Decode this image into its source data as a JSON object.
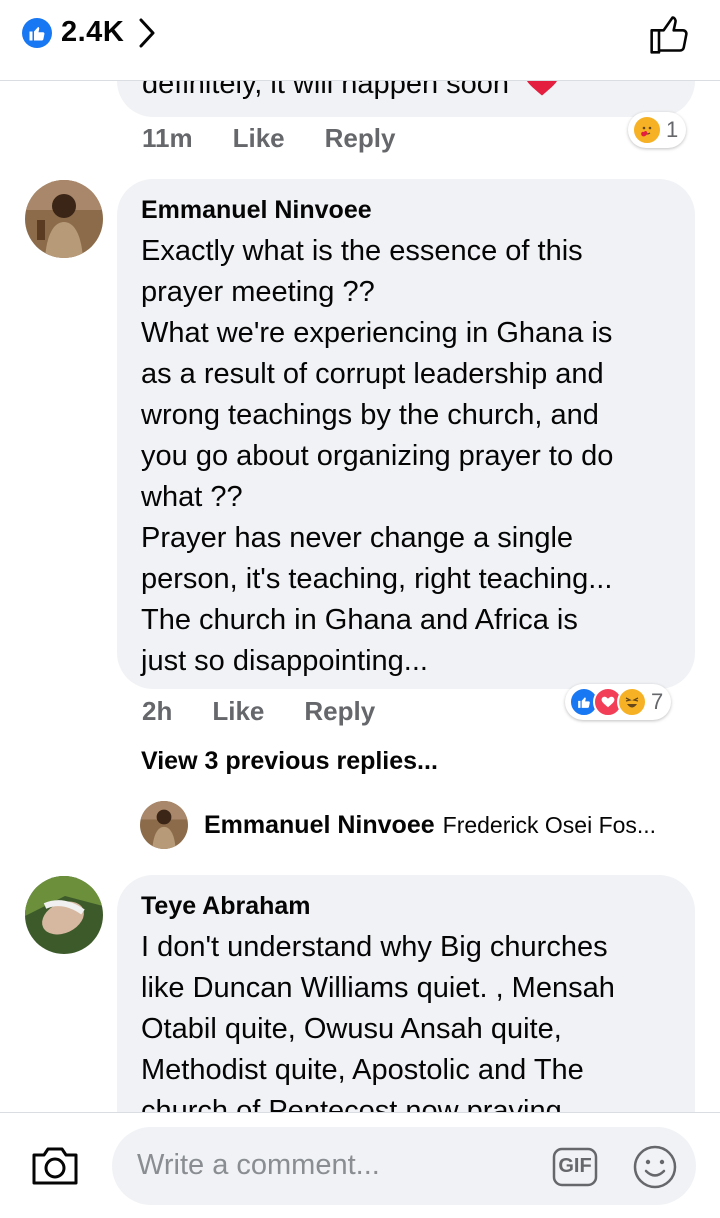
{
  "header": {
    "likes_count": "2.4K",
    "like_icon": "thumbs-up-icon",
    "accent": "#1877f2"
  },
  "comments": [
    {
      "truncated_text": "definitely, it will happen soon",
      "time": "11m",
      "like_label": "Like",
      "reply_label": "Reply",
      "reaction_count": "1"
    },
    {
      "author": "Emmanuel Ninvoee",
      "lines": [
        "Exactly what is the essence of this",
        "prayer meeting ??",
        "What we're experiencing in Ghana is",
        "as a result of corrupt leadership and",
        "wrong teachings by the church, and",
        "you go about organizing prayer to do",
        "what ??",
        "Prayer has never change a single",
        "person, it's teaching, right teaching...",
        "The church in Ghana and Africa is",
        "just so disappointing..."
      ],
      "time": "2h",
      "like_label": "Like",
      "reply_label": "Reply",
      "reaction_count": "7",
      "view_previous": "View 3 previous replies...",
      "latest_reply": {
        "author": "Emmanuel Ninvoee",
        "text": "Frederick Osei Fos..."
      }
    },
    {
      "author": "Teye Abraham",
      "lines": [
        "I don't understand why Big churches",
        "like Duncan Williams quiet. , Mensah",
        "Otabil quite, Owusu Ansah quite,",
        "Methodist quite, Apostolic and The",
        "church of Pentecost now praving"
      ]
    }
  ],
  "composer": {
    "placeholder": "Write a comment...",
    "gif_label": "GIF"
  }
}
